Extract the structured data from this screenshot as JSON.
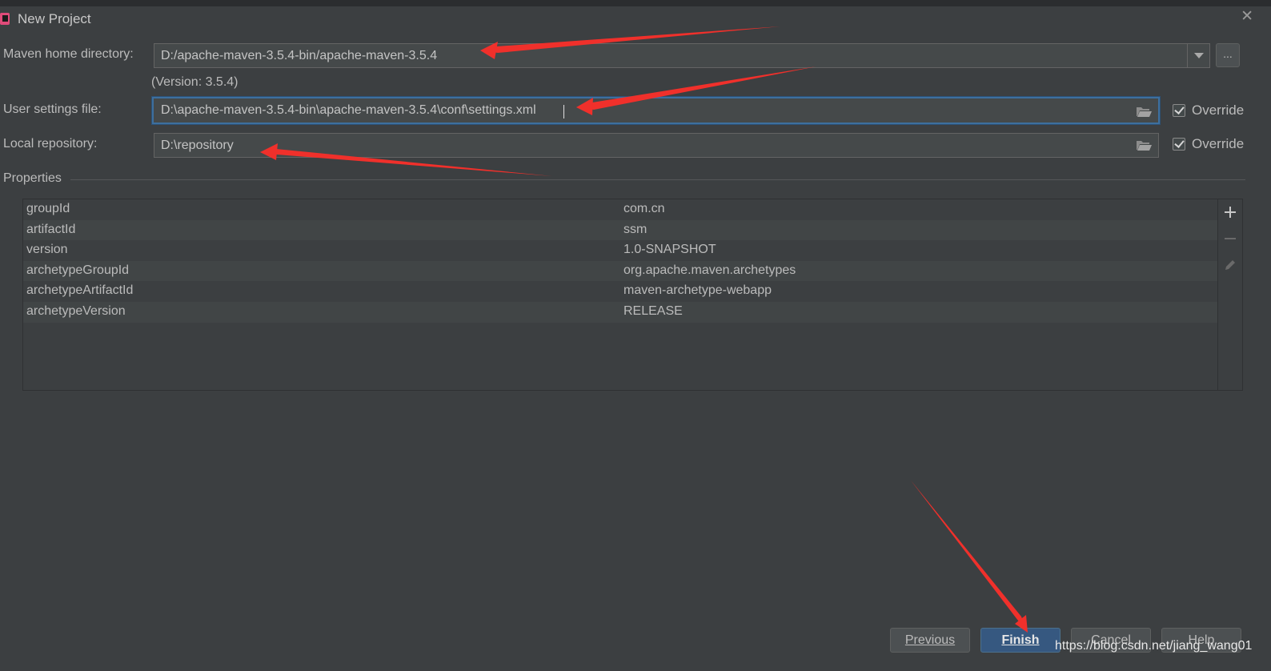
{
  "window": {
    "title": "New Project",
    "close_glyph": "✕"
  },
  "maven_home": {
    "label": "Maven home directory:",
    "value": "D:/apache-maven-3.5.4-bin/apache-maven-3.5.4",
    "version_text": "(Version: 3.5.4)",
    "browse_label": "..."
  },
  "user_settings": {
    "label": "User settings file:",
    "value": "D:\\apache-maven-3.5.4-bin\\apache-maven-3.5.4\\conf\\settings.xml",
    "override_label": "Override",
    "override_checked": true
  },
  "local_repo": {
    "label": "Local repository:",
    "value": "D:\\repository",
    "override_label": "Override",
    "override_checked": true
  },
  "properties": {
    "title": "Properties",
    "rows": [
      {
        "key": "groupId",
        "value": "com.cn"
      },
      {
        "key": "artifactId",
        "value": "ssm"
      },
      {
        "key": "version",
        "value": "1.0-SNAPSHOT"
      },
      {
        "key": "archetypeGroupId",
        "value": "org.apache.maven.archetypes"
      },
      {
        "key": "archetypeArtifactId",
        "value": "maven-archetype-webapp"
      },
      {
        "key": "archetypeVersion",
        "value": "RELEASE"
      }
    ],
    "tools": {
      "add": "+",
      "remove": "−"
    }
  },
  "buttons": {
    "previous": "Previous",
    "finish": "Finish",
    "cancel": "Cancel",
    "help": "Help"
  },
  "watermark": "https://blog.csdn.net/jiang_wang01",
  "colors": {
    "background": "#3c3f41",
    "field": "#45494a",
    "focus_border": "#3d6f9e",
    "primary_button": "#365880",
    "annotation_arrow": "#f0302b"
  }
}
